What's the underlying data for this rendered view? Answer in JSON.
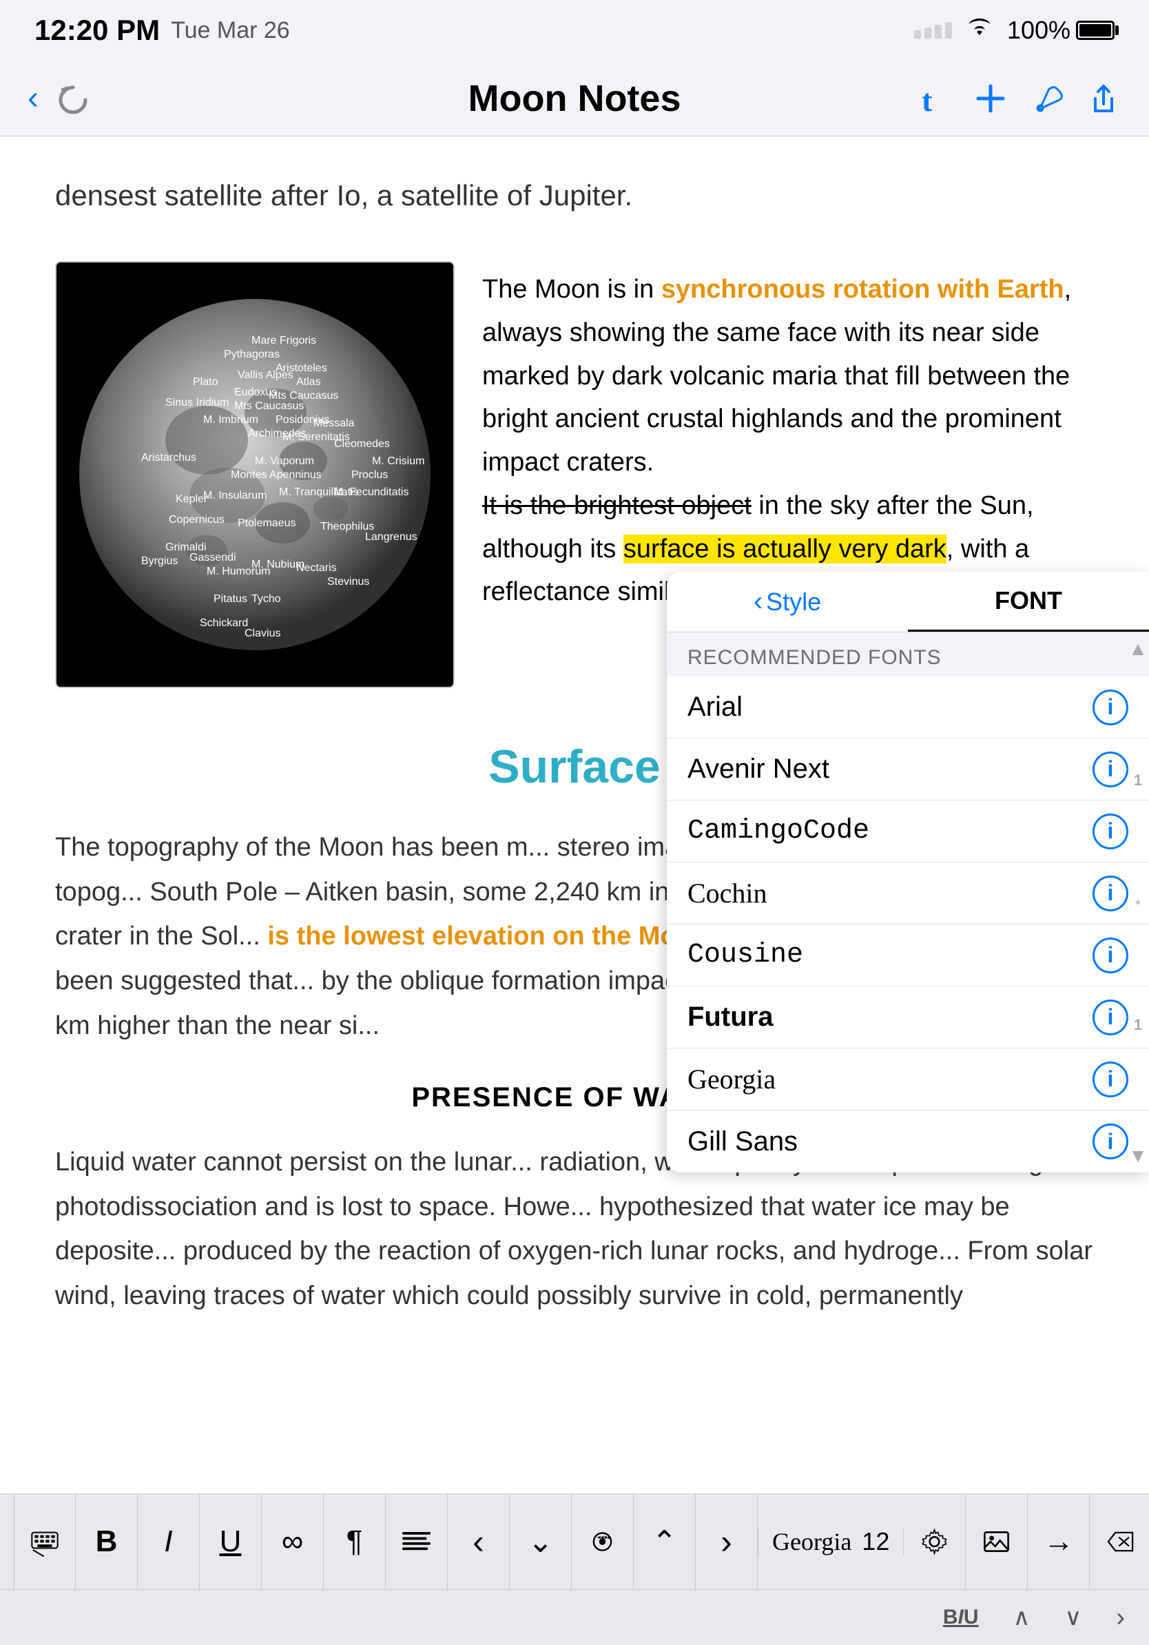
{
  "statusBar": {
    "time": "12:20 PM",
    "date": "Tue Mar 26",
    "battery": "100%"
  },
  "navBar": {
    "title": "Moon Notes",
    "backLabel": "‹",
    "undoLabel": "↩",
    "icons": [
      "tumblr",
      "plus",
      "wrench",
      "share"
    ]
  },
  "document": {
    "introText": "densest satellite after Io, a satellite of Jupiter.",
    "moonDescription": {
      "text1": "The Moon is in ",
      "orange1": "synchronous rotation with Earth",
      "text2": ", always showing the same face with its near side marked by dark volcanic maria that fill between the bright ancient crustal highlands and the prominent impact craters.",
      "strikethrough": "It is the brightest object",
      "text3": " in the sky after the Sun, although its ",
      "highlighted": "surface is actually very dark",
      "text4": ", with a reflectance similar to that of coal."
    },
    "surfaceHeading": "Surface",
    "surfaceText": "The topography of the Moon has been m... stereo image analysis. The most visible topog... South Pole – Aitken basin, some 2,240 km in... Moon and the largest known crater in the Sol...",
    "orangeText": "is the lowest elevation on the Moon",
    "surfaceText2": ". Th... its north-east, and it has been suggested that... by the oblique formation impact of South Pol... average about 1.9 km higher than the near si...",
    "waterHeading": "PRESENCE OF WATER",
    "waterText": "Liquid water cannot persist on the lunar... radiation, water quickly decomposes through... photodissociation and is lost to space. Howe... hypothesized that water ice may be deposite... produced by the reaction of oxygen-rich lunar rocks, and hydroge... From solar wind, leaving traces of water which could possibly survive in cold, permanently"
  },
  "fontPanel": {
    "styleLabel": "Style",
    "fontLabel": "FONT",
    "backChevron": "‹",
    "sectionHeader": "RECOMMENDED FONTS",
    "fonts": [
      {
        "name": "Arial",
        "style": "normal"
      },
      {
        "name": "Avenir Next",
        "style": "normal"
      },
      {
        "name": "CamingoCode",
        "style": "monospace"
      },
      {
        "name": "Cochin",
        "style": "normal"
      },
      {
        "name": "Cousine",
        "style": "monospace"
      },
      {
        "name": "Futura",
        "style": "bold"
      },
      {
        "name": "Georgia",
        "style": "normal"
      },
      {
        "name": "Gill Sans",
        "style": "normal"
      }
    ],
    "infoButtonLabel": "i"
  },
  "toolbar": {
    "boldLabel": "B",
    "italicLabel": "I",
    "underlineLabel": "U",
    "infinityLabel": "∞",
    "paragraphLabel": "¶",
    "alignLabel": "≡",
    "prevLabel": "‹",
    "nextChevron": "›",
    "chevronDown": "⌄",
    "audioLabel": "◉",
    "chevronUp": "⌃",
    "chevronRight": "›",
    "currentFont": "Georgia",
    "currentSize": "12",
    "settingsLabel": "⚙",
    "imageLabel": "⬜",
    "rightArrowLabel": "→",
    "deleteLabel": "⌫",
    "keyboardLabel": "⌨",
    "row2": {
      "biuLabel": "BIU",
      "chevronUpLabel": "∧",
      "chevronDownLabel": "∨",
      "chevronRightLabel": "›"
    }
  }
}
